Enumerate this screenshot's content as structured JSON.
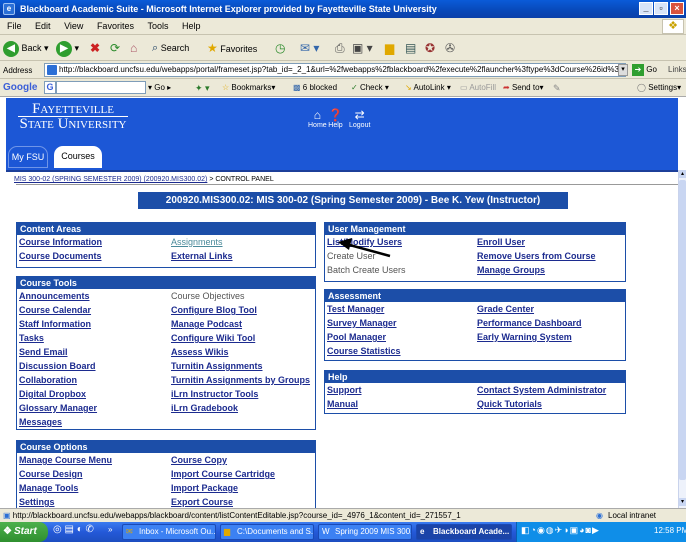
{
  "window": {
    "title": "Blackboard Academic Suite - Microsoft Internet Explorer provided by Fayetteville State University"
  },
  "menu": [
    "File",
    "Edit",
    "View",
    "Favorites",
    "Tools",
    "Help"
  ],
  "toolbar": {
    "back": "Back",
    "search": "Search",
    "favorites": "Favorites"
  },
  "address": {
    "label": "Address",
    "url": "http://blackboard.uncfsu.edu/webapps/portal/frameset.jsp?tab_id=_2_1&url=%2fwebapps%2fblackboard%2fexecute%2flauncher%3ftype%3dCourse%26id%3d_4976_1%",
    "go": "Go",
    "links": "Links"
  },
  "google": {
    "label": "Google",
    "bookmarks": "Bookmarks",
    "blocked": "6 blocked",
    "check": "Check",
    "autolink": "AutoLink",
    "autofill": "AutoFill",
    "sendto": "Send to",
    "settings": "Settings"
  },
  "university": {
    "line1": "Fayetteville",
    "line2": "State University"
  },
  "header_links": [
    "Home",
    "Help",
    "Logout"
  ],
  "tabs": [
    "My FSU",
    "Courses"
  ],
  "breadcrumb": {
    "course": "MIS 300-02 (SPRING SEMESTER 2009) (200920.MIS300.02)",
    "sep": ">",
    "current": "CONTROL PANEL"
  },
  "course_title": "200920.MIS300.02: MIS 300-02 (Spring Semester 2009) - Bee K. Yew (Instructor)",
  "content_areas": {
    "heading": "Content Areas",
    "items": [
      "Course Information",
      "Assignments",
      "Course Documents",
      "External Links"
    ]
  },
  "course_tools": {
    "heading": "Course Tools",
    "items": [
      "Announcements",
      "Course Objectives",
      "Course Calendar",
      "Configure Blog Tool",
      "Staff Information",
      "Manage Podcast",
      "Tasks",
      "Configure Wiki Tool",
      "Send Email",
      "Assess Wikis",
      "Discussion Board",
      "Turnitin Assignments",
      "Collaboration",
      "Turnitin Assignments by Groups",
      "Digital Dropbox",
      "iLrn Instructor Tools",
      "Glossary Manager",
      "iLrn Gradebook",
      "Messages"
    ]
  },
  "course_options": {
    "heading": "Course Options",
    "items": [
      "Manage Course Menu",
      "Course Copy",
      "Course Design",
      "Import Course Cartridge",
      "Manage Tools",
      "Import Package",
      "Settings",
      "Export Course"
    ]
  },
  "user_management": {
    "heading": "User Management",
    "items": [
      "List/Modify Users",
      "Enroll User",
      "Create User",
      "Remove Users from Course",
      "Batch Create Users",
      "Manage Groups"
    ]
  },
  "assessment": {
    "heading": "Assessment",
    "items": [
      "Test Manager",
      "Grade Center",
      "Survey Manager",
      "Performance Dashboard",
      "Pool Manager",
      "Early Warning System",
      "Course Statistics"
    ]
  },
  "help": {
    "heading": "Help",
    "items": [
      "Support",
      "Contact System Administrator",
      "Manual",
      "Quick Tutorials"
    ]
  },
  "status": {
    "url": "http://blackboard.uncfsu.edu/webapps/blackboard/content/listContentEditable.jsp?course_id=_4976_1&content_id=_271557_1",
    "zone": "Local intranet"
  },
  "taskbar": {
    "start": "Start",
    "tasks": [
      "Inbox - Microsoft Ou...",
      "C:\\Documents and S...",
      "Spring 2009 MIS 300...",
      "Blackboard Acade..."
    ],
    "clock": "12:58 PM"
  },
  "colors": {
    "header_blue": "#1c57d6",
    "box_head": "#1c4ea8",
    "title_bar": "#0a5bd8"
  }
}
